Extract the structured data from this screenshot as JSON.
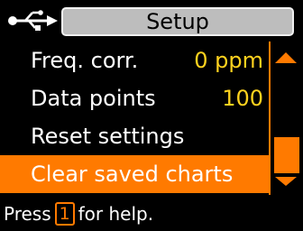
{
  "header": {
    "icon": "usb-icon",
    "title": "Setup"
  },
  "menu": {
    "items": [
      {
        "label": "Freq. corr.",
        "value": "0 ppm",
        "selected": false
      },
      {
        "label": "Data points",
        "value": "100",
        "selected": false
      },
      {
        "label": "Reset settings",
        "value": "",
        "selected": false
      },
      {
        "label": "Clear saved charts",
        "value": "",
        "selected": true
      }
    ]
  },
  "scrollbar": {
    "up_icon": "chevron-up-icon",
    "down_icon": "chevron-down-icon"
  },
  "footer": {
    "prefix": "Press",
    "key": "1",
    "suffix": "for help."
  },
  "colors": {
    "accent": "#ff7a00",
    "value": "#ffd21e",
    "title_bg": "#bdbdbd",
    "background": "#000000",
    "text": "#ffffff"
  }
}
